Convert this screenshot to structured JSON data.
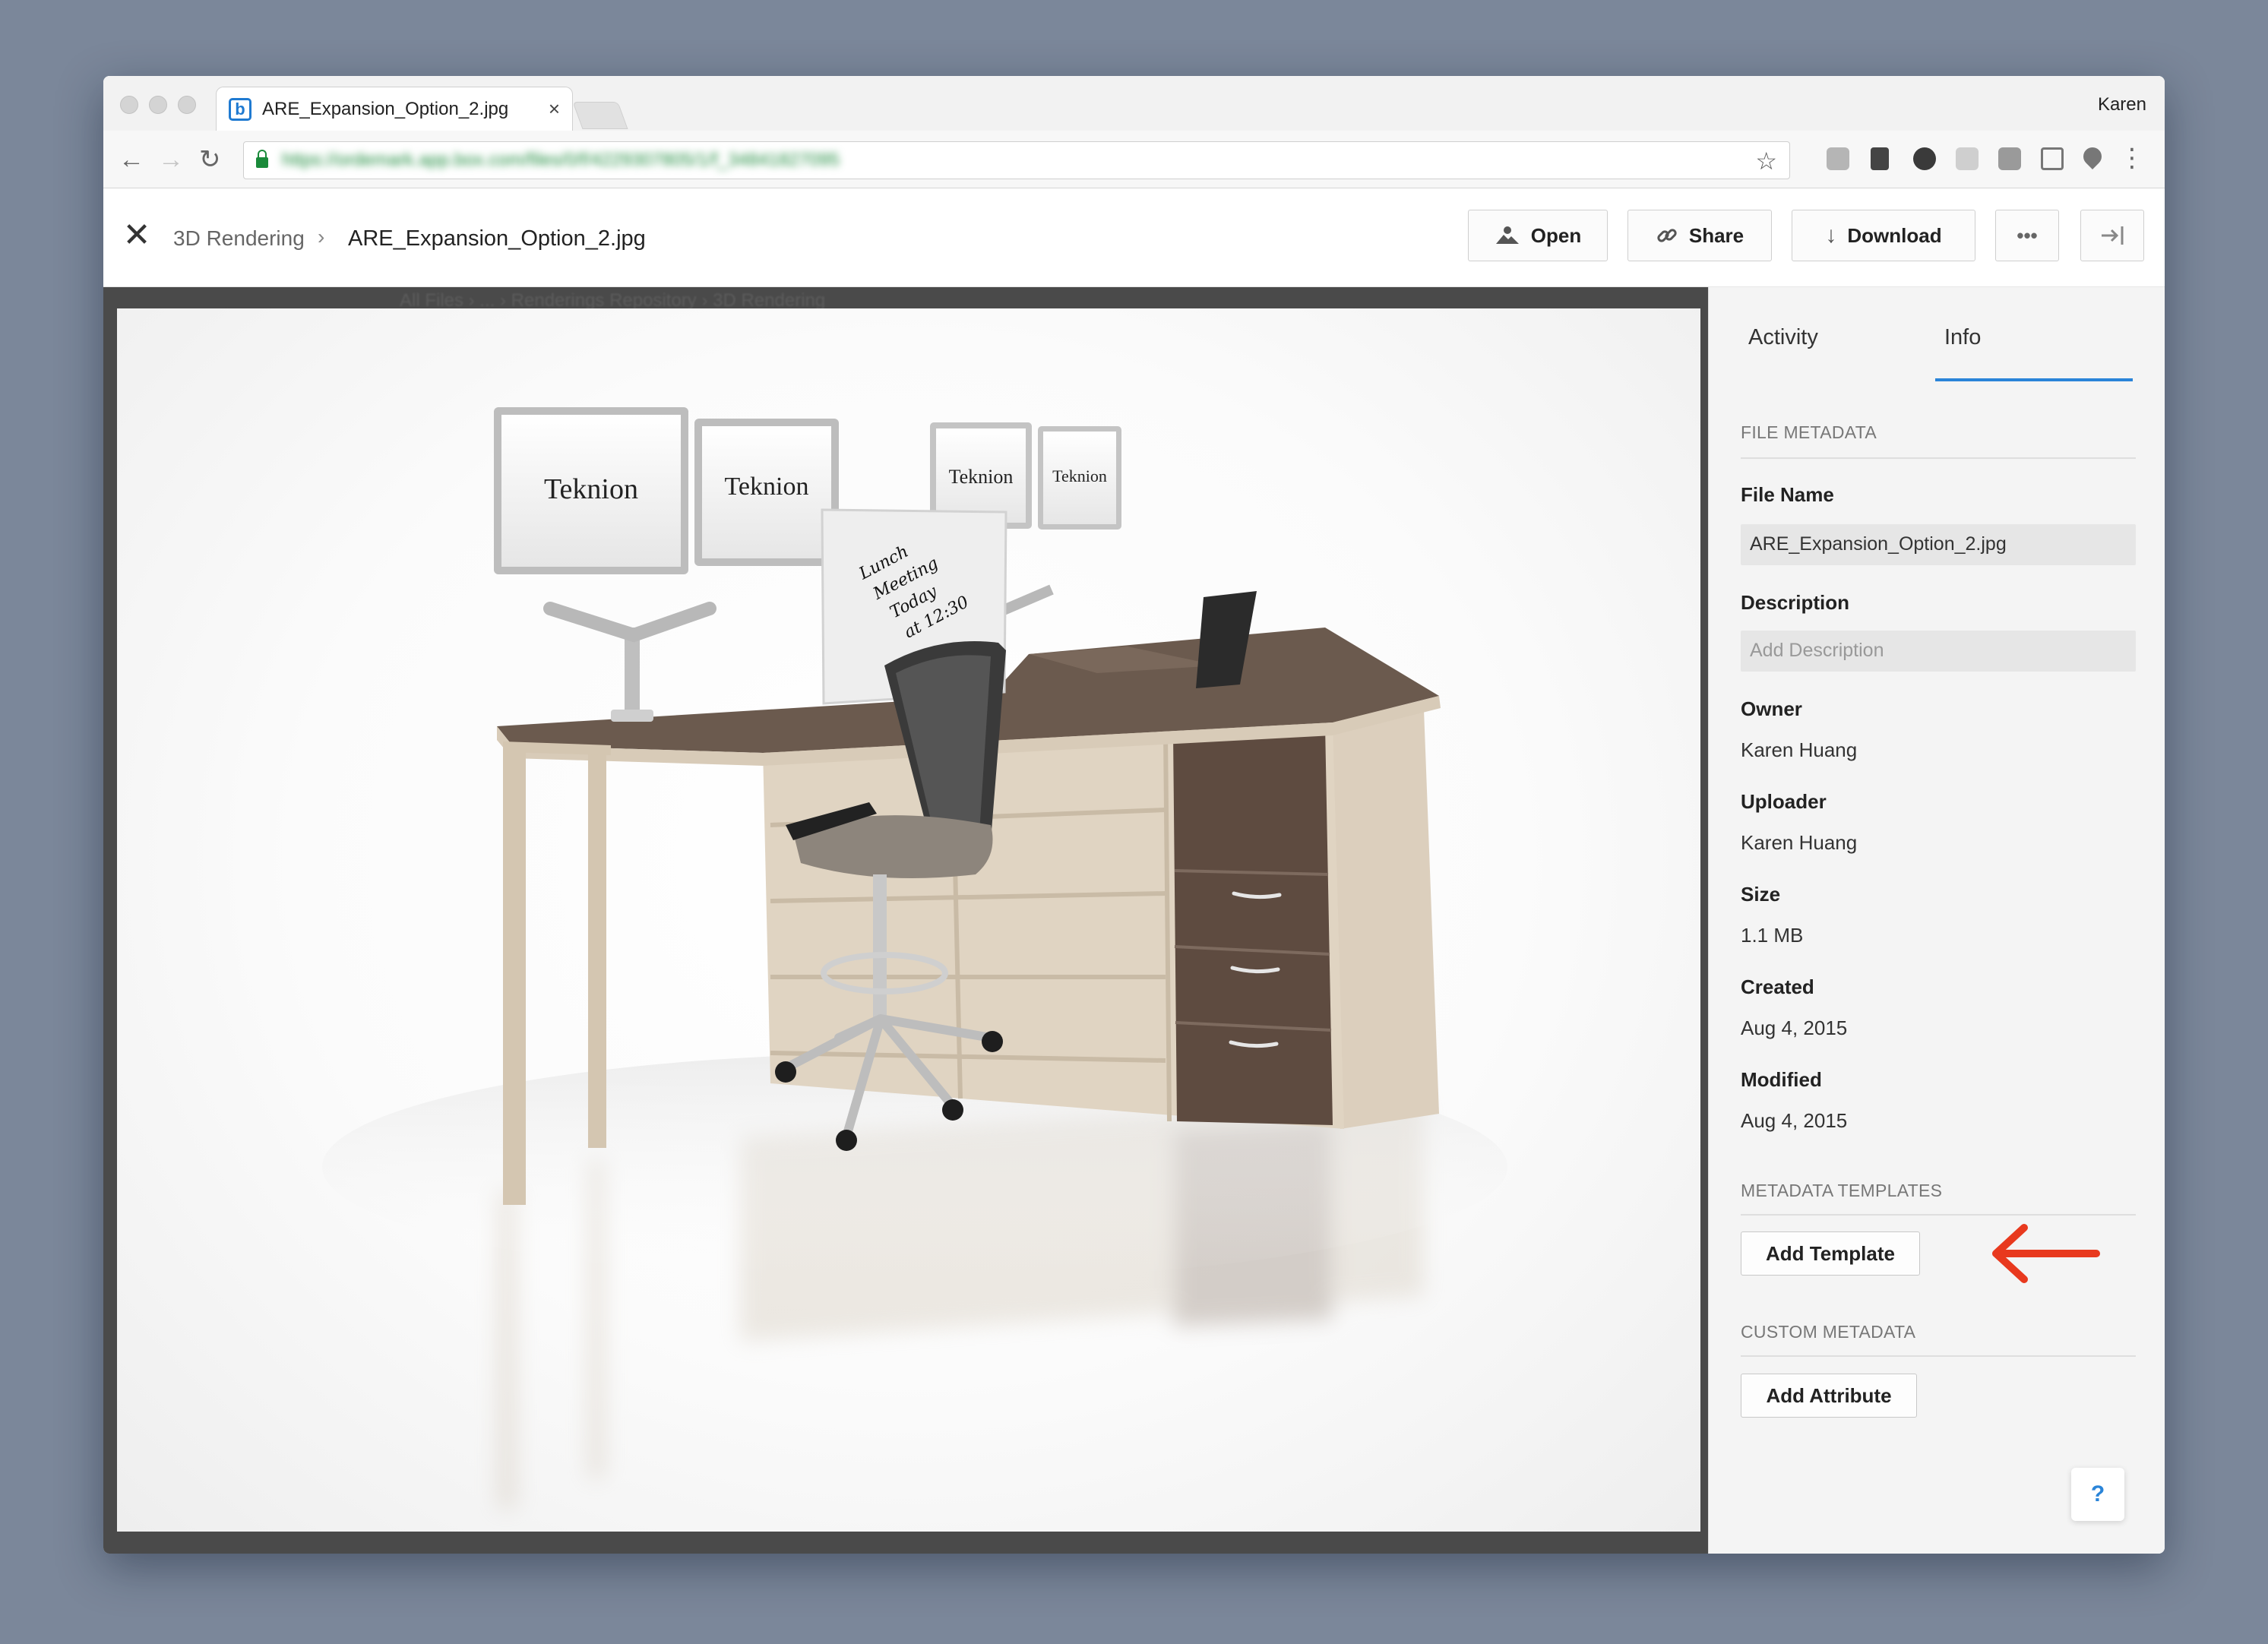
{
  "browser": {
    "tab_title": "ARE_Expansion_Option_2.jpg",
    "tab_favicon": "b",
    "profile_name": "Karen",
    "url": "https://ordemark.app.box.com/files/0/f/4229307805/1/f_34841827095"
  },
  "header": {
    "breadcrumb_parent": "3D Rendering",
    "breadcrumb_current": "ARE_Expansion_Option_2.jpg",
    "buttons": {
      "open": "Open",
      "share": "Share",
      "download": "Download",
      "more": "•••"
    }
  },
  "preview": {
    "ghost_breadcrumb": "All Files  ›  ...  ›  Renderings Repository  ›  3D Rendering",
    "monitor_brand": "Teknion",
    "note_text": [
      "Lunch",
      "Meeting",
      "Today",
      "at 12:30"
    ]
  },
  "sidebar": {
    "tabs": [
      "Activity",
      "Info"
    ],
    "active_tab": "Info",
    "file_metadata_title": "FILE METADATA",
    "fields": {
      "file_name_label": "File Name",
      "file_name_value": "ARE_Expansion_Option_2.jpg",
      "description_label": "Description",
      "description_placeholder": "Add Description",
      "owner_label": "Owner",
      "owner_value": "Karen Huang",
      "uploader_label": "Uploader",
      "uploader_value": "Karen Huang",
      "size_label": "Size",
      "size_value": "1.1 MB",
      "created_label": "Created",
      "created_value": "Aug 4, 2015",
      "modified_label": "Modified",
      "modified_value": "Aug 4, 2015"
    },
    "metadata_templates_title": "METADATA TEMPLATES",
    "add_template_label": "Add Template",
    "custom_metadata_title": "CUSTOM METADATA",
    "add_attribute_label": "Add Attribute",
    "help_label": "?"
  },
  "colors": {
    "accent": "#2a84d8",
    "annotation_arrow": "#e8391e",
    "desk_top": "#6b5a4e",
    "desk_frame": "#d8cbb8",
    "cabinet": "#5e4b40"
  }
}
